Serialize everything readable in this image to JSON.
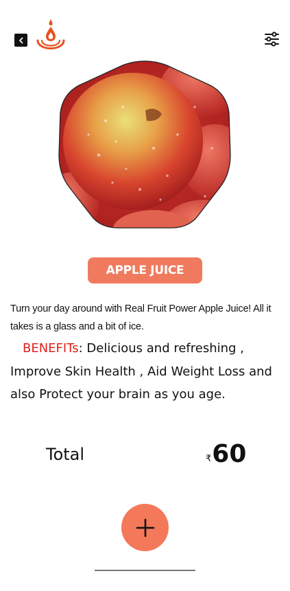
{
  "header": {
    "back_icon": "chevron-left-icon",
    "logo_icon": "juice-drop-logo",
    "filter_icon": "sliders-icon"
  },
  "product": {
    "image_subject": "apple",
    "name": "APPLE JUICE",
    "description": "Turn your day around with Real Fruit Power Apple Juice! All it takes is a glass and a bit of ice.",
    "benefits_label": "BENEFITs",
    "benefits_text": ":  Delicious and refreshing , Improve Skin Health , Aid Weight Loss and also Protect your brain as you age."
  },
  "total": {
    "label": "Total",
    "currency": "₹",
    "amount": "60"
  },
  "actions": {
    "add_icon": "plus-icon"
  },
  "colors": {
    "accent": "#f07a5e",
    "benefits_highlight": "#e0201c",
    "logo_orange": "#e8501e"
  }
}
